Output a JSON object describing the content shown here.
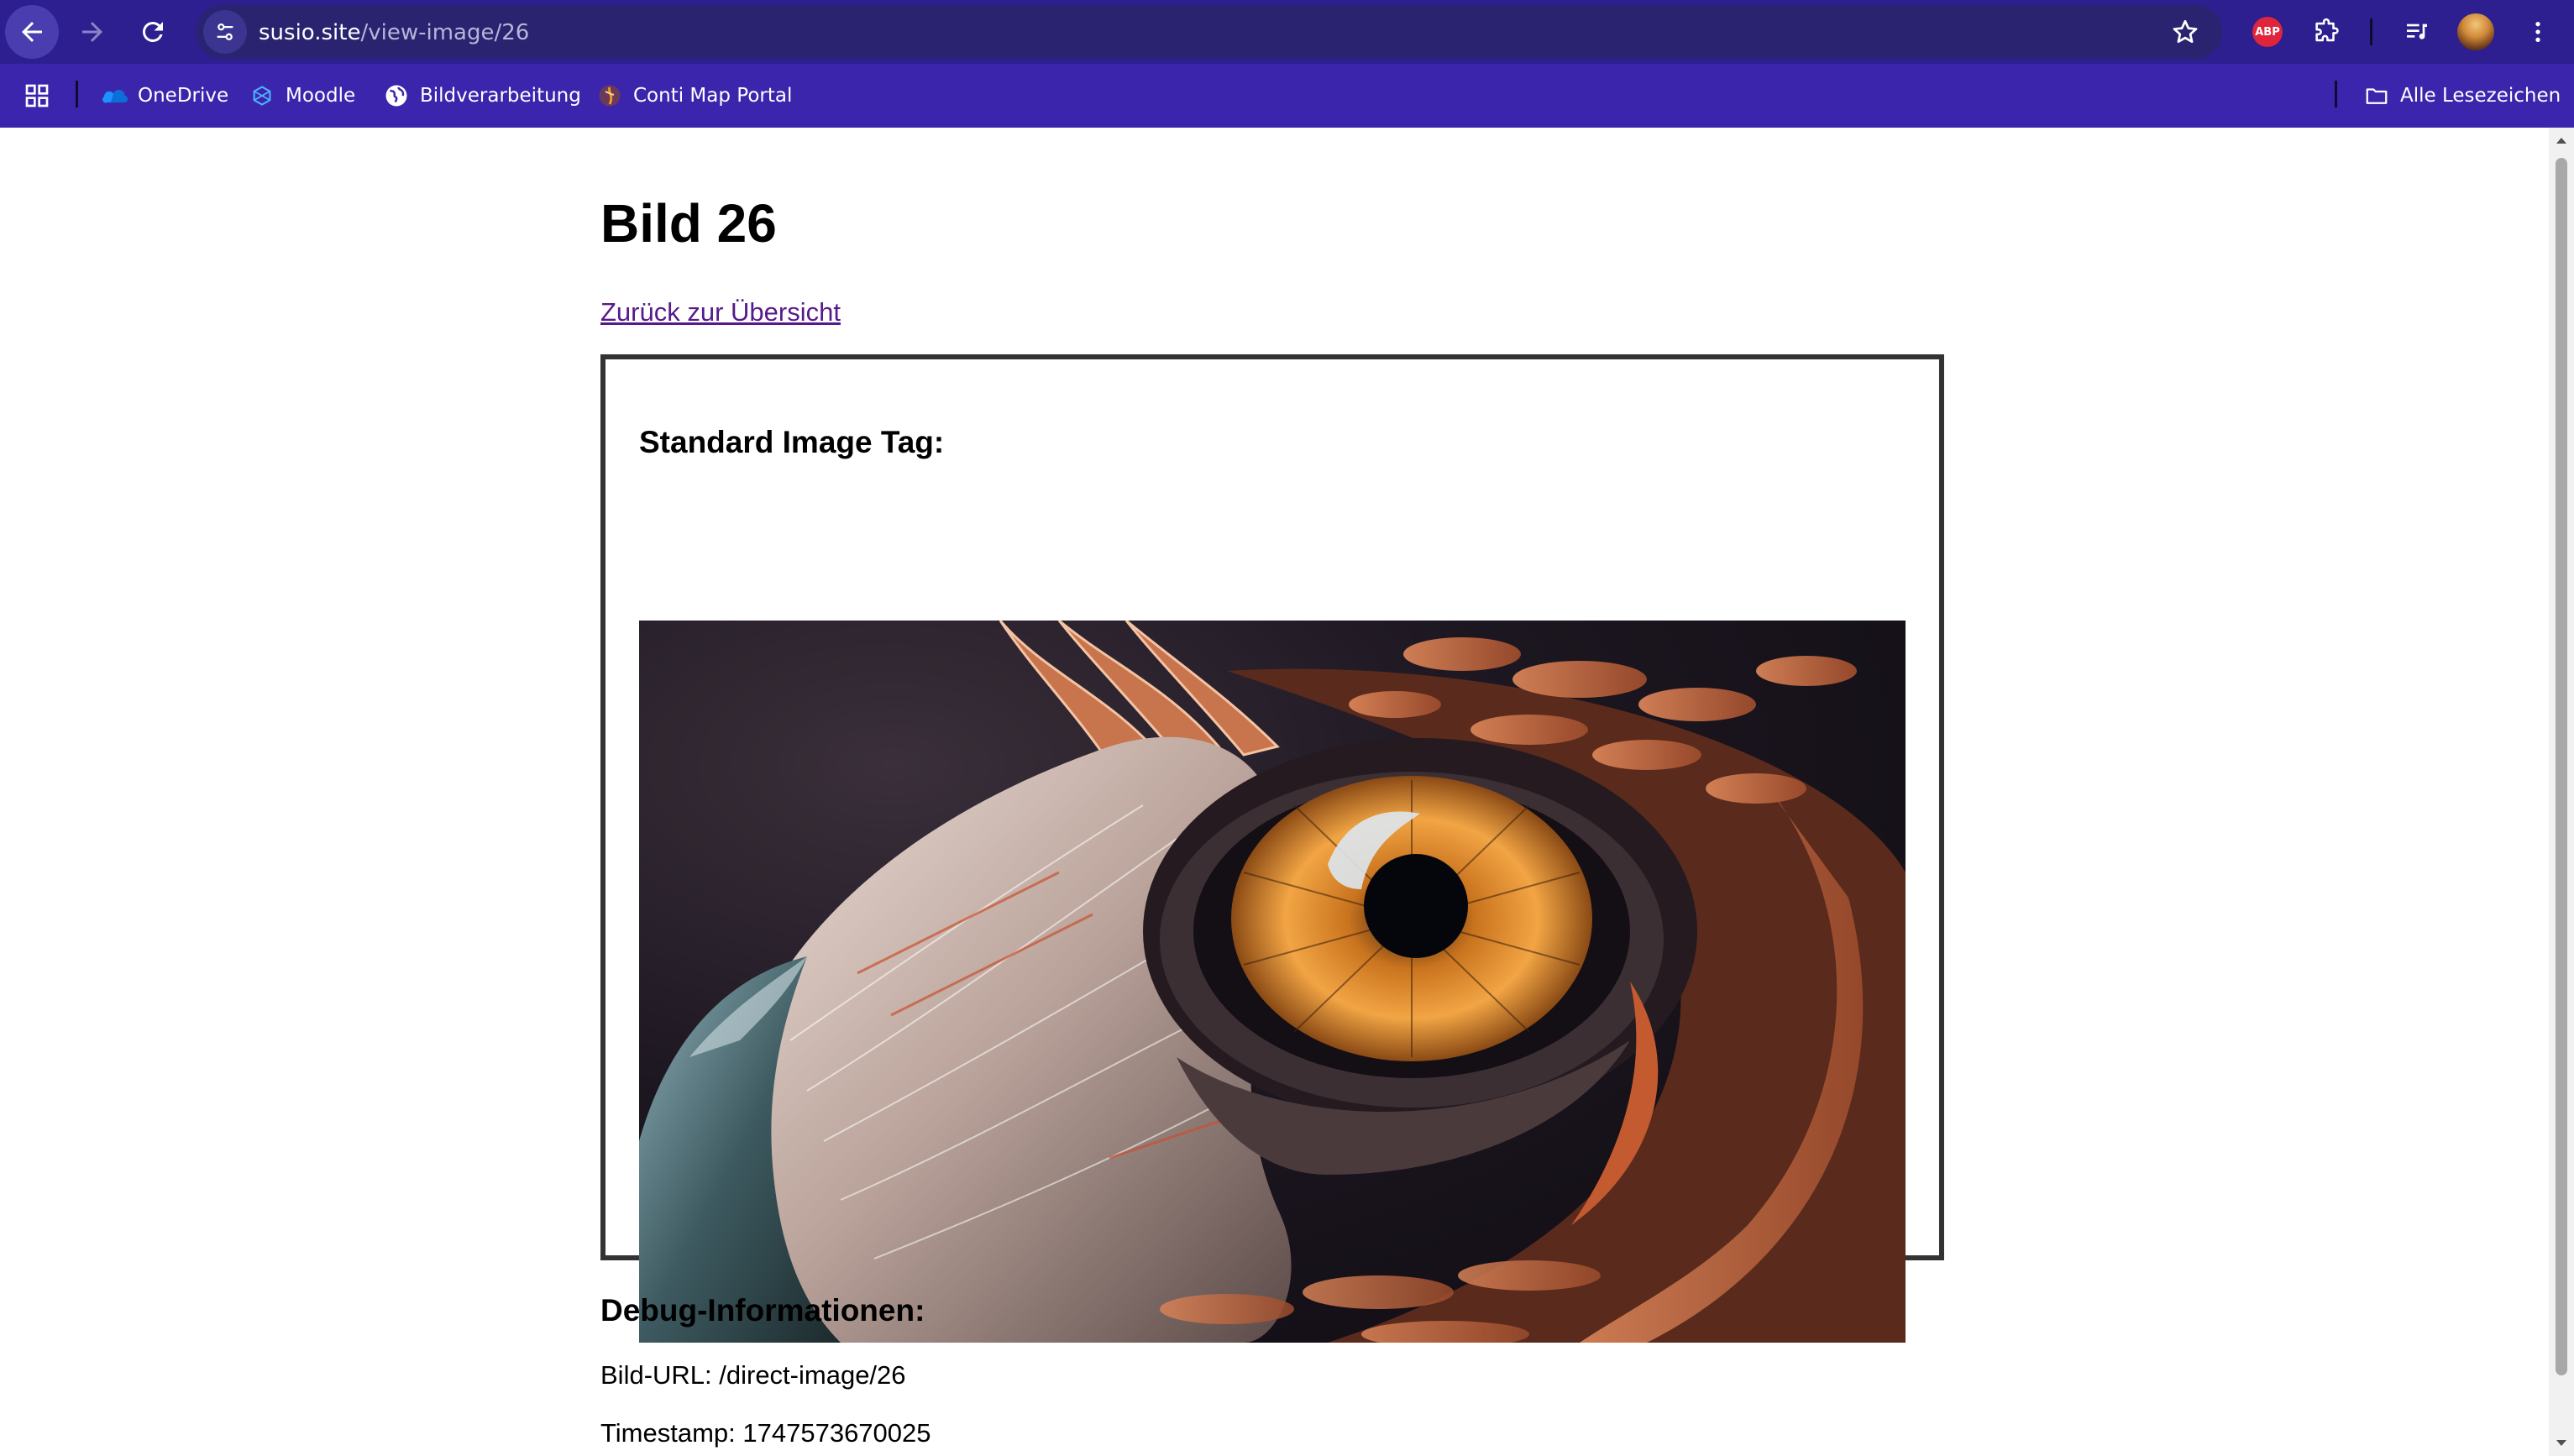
{
  "browser": {
    "url_host": "susio.site",
    "url_path": "/view-image/26",
    "accent_color": "#2d1f8f",
    "bookmarks_bar_color": "#3b25ad",
    "adblock_label": "ABP",
    "bookmarks": [
      {
        "label": "OneDrive",
        "icon": "onedrive-icon"
      },
      {
        "label": "Moodle",
        "icon": "moodle-icon"
      },
      {
        "label": "Bildverarbeitung",
        "icon": "globe-icon"
      },
      {
        "label": "Conti Map Portal",
        "icon": "map-portal-icon"
      }
    ],
    "all_bookmarks_label": "Alle Lesezeichen"
  },
  "page": {
    "title": "Bild 26",
    "back_link": "Zurück zur Übersicht",
    "image_section_title": "Standard Image Tag:",
    "image_alt": "Bild 26",
    "debug": {
      "title": "Debug-Informationen:",
      "url_line": "Bild-URL: /direct-image/26",
      "timestamp_line": "Timestamp: 1747573670025"
    }
  }
}
